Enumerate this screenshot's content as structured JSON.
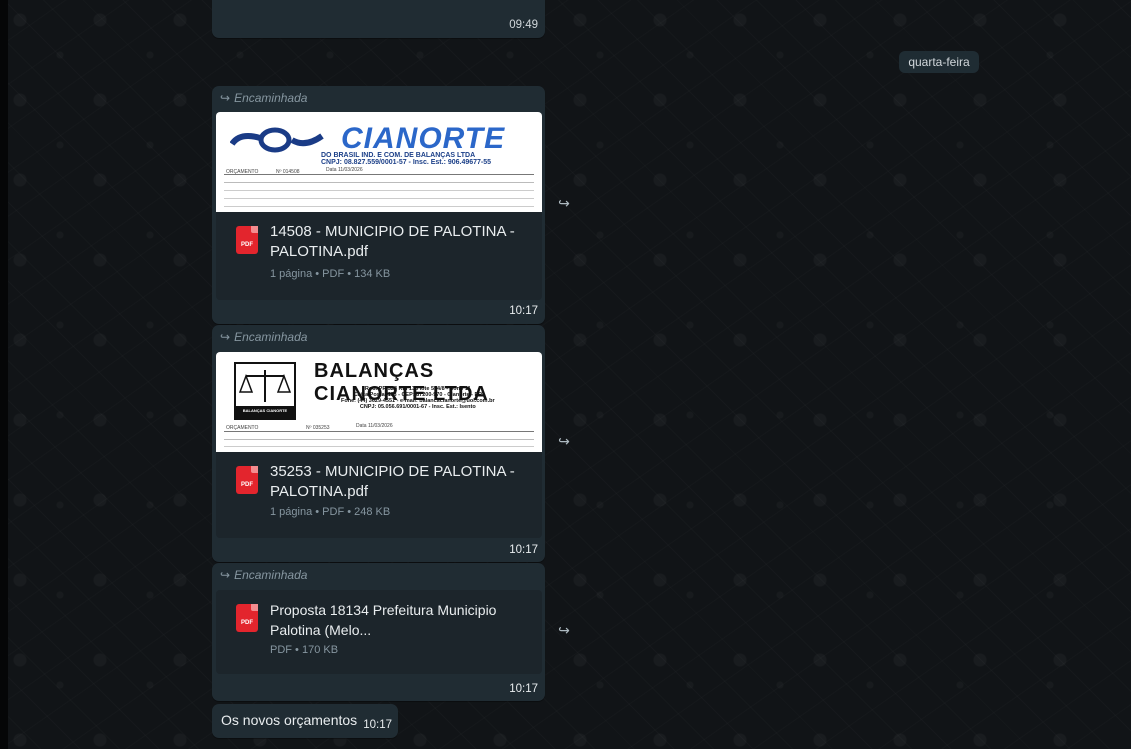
{
  "date_separator": "quarta-feira",
  "previous_message": {
    "time": "09:49"
  },
  "messages": [
    {
      "forwarded_label": "Encaminhada",
      "preview": {
        "brand": "CIANORTE",
        "subtitle": "DO BRASIL IND. E COM. DE BALANÇAS LTDA",
        "subtitle2": "CNPJ: 08.827.559/0001-57 - Insc. Est.: 906.49677-55",
        "row1_left": "ORÇAMENTO",
        "row1_mid": "Nº 014508",
        "row1_right": "Data 11/03/2026"
      },
      "file_name": "14508 - MUNICIPIO DE PALOTINA - PALOTINA.pdf",
      "file_meta": "1 página • PDF • 134 KB",
      "time": "10:17"
    },
    {
      "forwarded_label": "Encaminhada",
      "preview": {
        "brand": "BALANÇAS CIANORTE LTDA",
        "line1": "Rod. PR 323 Km 138 lote 594/8 - Sono 11",
        "line2": "Caixa Postal 118 - CEP: 87200-970 - Cianorte - PR",
        "line3": "Fone: (44) 3629-4551 - e-mail: balancacianorte@uol.com.br",
        "line4": "CNPJ: 05.056.691/0001-67 - Insc. Est.: Isento",
        "logo_caption": "BALANÇAS CIANORTE",
        "row1_left": "ORÇAMENTO",
        "row1_mid": "Nº 035253",
        "row1_right": "Data 11/03/2026"
      },
      "file_name": "35253 - MUNICIPIO DE PALOTINA - PALOTINA.pdf",
      "file_meta": "1 página • PDF • 248 KB",
      "time": "10:17"
    },
    {
      "forwarded_label": "Encaminhada",
      "file_name": "Proposta 18134 Prefeitura Municipio Palotina (Melo...",
      "file_meta": "PDF • 170 KB",
      "time": "10:17"
    },
    {
      "text": "Os novos orçamentos",
      "time": "10:17"
    }
  ],
  "icons": {
    "pdf_badge": "PDF",
    "forward_glyph": "↪",
    "forwarded_glyph": "↪"
  }
}
